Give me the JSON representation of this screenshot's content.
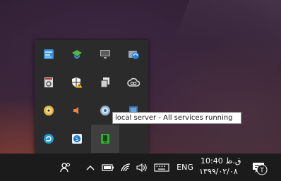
{
  "tooltip": {
    "text": "local server - All services running"
  },
  "tray": {
    "icons": [
      {
        "name": "network-monitor-icon"
      },
      {
        "name": "game-controller-icon"
      },
      {
        "name": "monitor-display-icon"
      },
      {
        "name": "browser-sync-icon"
      },
      {
        "name": "safely-remove-drive-icon"
      },
      {
        "name": "security-shield-warning-icon"
      },
      {
        "name": "copy-files-icon"
      },
      {
        "name": "creative-cloud-icon"
      },
      {
        "name": "disc-media-icon"
      },
      {
        "name": "speaker-icon"
      },
      {
        "name": "ie-edge-icon"
      },
      {
        "name": "blue-app-icon"
      },
      {
        "name": "refresh-sync-icon"
      },
      {
        "name": "skype-business-icon"
      },
      {
        "name": "local-server-icon"
      }
    ]
  },
  "taskbar": {
    "language": "ENG",
    "time": "ق.ظ 10:40",
    "date": "۱۳۹۹/۰۲/۰۸"
  },
  "colors": {
    "flyout_bg": "#2b2b2b",
    "taskbar_bg": "#1b1b1b",
    "server_icon_green": "#35a835"
  }
}
